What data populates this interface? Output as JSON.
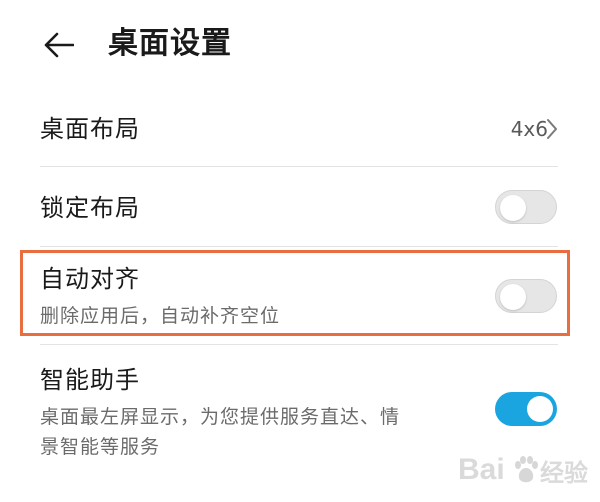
{
  "header": {
    "title": "桌面设置",
    "back_icon": "arrow-left-icon"
  },
  "settings": [
    {
      "title": "桌面布局",
      "value": "4x6",
      "control": "chevron-right-icon"
    },
    {
      "title": "锁定布局",
      "control": "toggle",
      "enabled": false
    },
    {
      "title": "自动对齐",
      "subtitle": "删除应用后，自动补齐空位",
      "control": "toggle",
      "enabled": false,
      "highlighted": true
    },
    {
      "title": "智能助手",
      "subtitle_lines": [
        "桌面最左屏显示，为您提供服务直达、情",
        "景智能等服务"
      ],
      "control": "toggle",
      "enabled": true
    }
  ],
  "colors": {
    "accent": "#1aa5e0",
    "highlight": "#e86d3f",
    "toggle_off": "#e6e6e6"
  },
  "watermark": {
    "text_left": "Bai",
    "text_right": "经验",
    "logo": "paw-logo"
  }
}
